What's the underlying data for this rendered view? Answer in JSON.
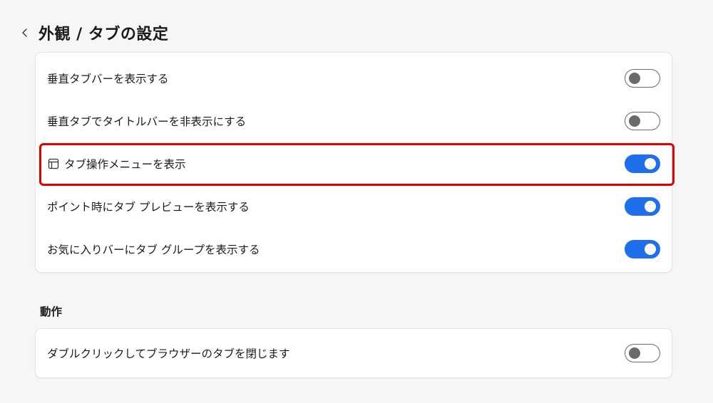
{
  "header": {
    "back_icon": "chevron-left-icon",
    "title": "外観 / タブの設定"
  },
  "tabs_card": {
    "rows": [
      {
        "label": "垂直タブバーを表示する",
        "enabled": false
      },
      {
        "label": "垂直タブでタイトルバーを非表示にする",
        "enabled": false
      },
      {
        "label": "タブ操作メニューを表示",
        "enabled": true,
        "icon": "tab-window-icon",
        "highlighted": true
      },
      {
        "label": "ポイント時にタブ プレビューを表示する",
        "enabled": true
      },
      {
        "label": "お気に入りバーにタブ グループを表示する",
        "enabled": true
      }
    ]
  },
  "behavior_section": {
    "title": "動作",
    "rows": [
      {
        "label": "ダブルクリックしてブラウザーのタブを閉じます",
        "enabled": false
      }
    ]
  },
  "colors": {
    "toggle_on": "#1f6feb",
    "toggle_off_border": "#6b6b6b",
    "highlight": "#e00000",
    "background": "#f6f6f6"
  }
}
